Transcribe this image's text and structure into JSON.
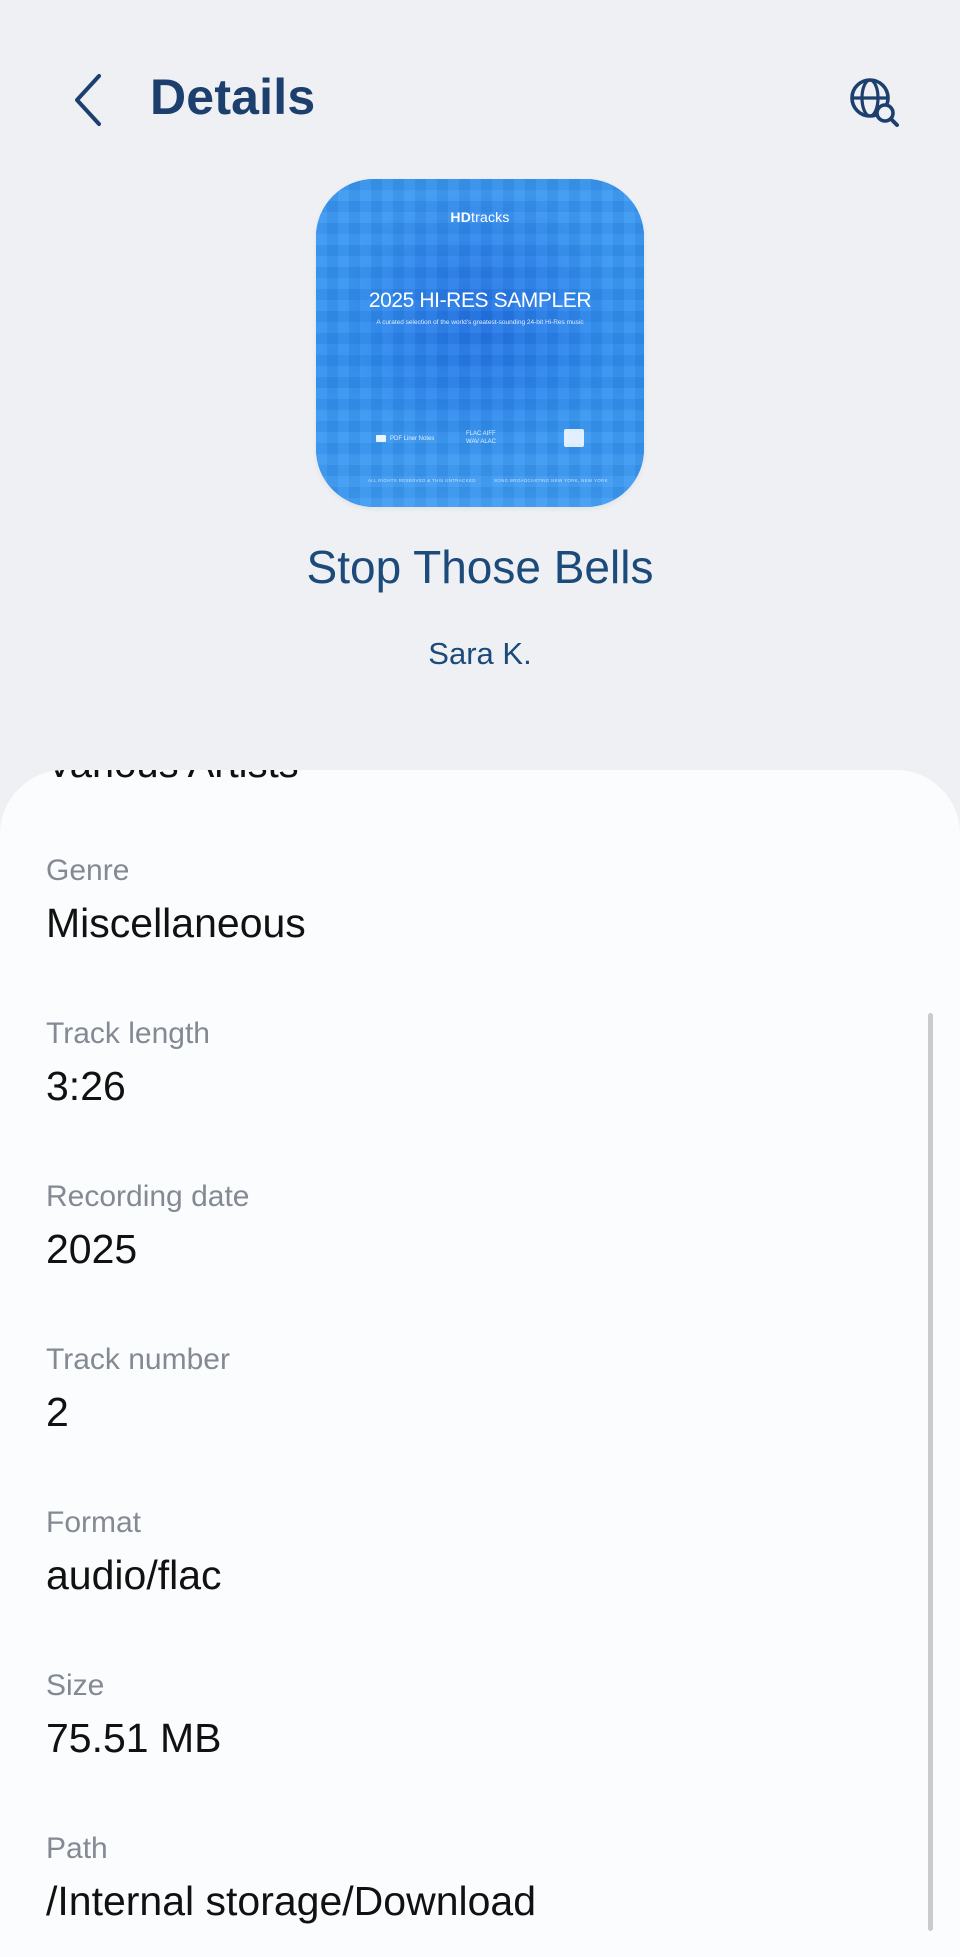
{
  "header": {
    "title": "Details",
    "back_icon": "chevron-left-icon",
    "search_icon": "globe-search-icon"
  },
  "album_art": {
    "brand_bold": "HD",
    "brand_rest": "tracks",
    "title": "2025 HI-RES SAMPLER",
    "subtitle": "A curated selection of the world's greatest-sounding 24-bit Hi-Res music",
    "foot_left": "PDF Liner Notes",
    "foot_mid_1": "FLAC AIFF",
    "foot_mid_2": "WAV ALAC",
    "bottom_left": "ALL RIGHTS RESERVED & THIS UNTRACKED",
    "bottom_right": "SONG BROADCASTING NEW YORK, NEW YORK"
  },
  "track": {
    "title": "Stop Those Bells",
    "artist": "Sara K."
  },
  "sheet": {
    "clipped_value": "Various Artists",
    "rows": [
      {
        "label": "Genre",
        "value": "Miscellaneous"
      },
      {
        "label": "Track length",
        "value": "3:26"
      },
      {
        "label": "Recording date",
        "value": "2025"
      },
      {
        "label": "Track number",
        "value": "2"
      },
      {
        "label": "Format",
        "value": "audio/flac"
      },
      {
        "label": "Size",
        "value": "75.51 MB"
      },
      {
        "label": "Path",
        "value": "/Internal storage/Download"
      }
    ]
  },
  "colors": {
    "background": "#eef0f4",
    "title_navy": "#1c3f6e",
    "track_blue": "#1c4a7a",
    "sheet": "#fbfcfd",
    "label_gray": "#838a93",
    "album_blue": "#2b8ff0"
  }
}
